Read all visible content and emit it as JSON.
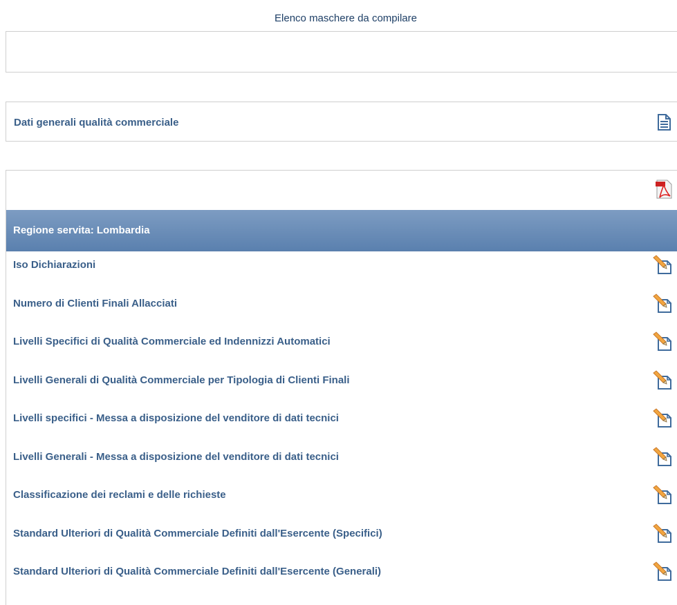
{
  "header": {
    "title": "Elenco maschere da compilare"
  },
  "general_section": {
    "label": "Dati generali qualità commerciale",
    "icon": "document-icon"
  },
  "list": {
    "pdf_icon": "pdf-icon",
    "region_header": "Regione servita: Lombardia",
    "items": [
      {
        "label": "Iso Dichiarazioni",
        "icon": "edit-icon"
      },
      {
        "label": "Numero di Clienti Finali Allacciati",
        "icon": "edit-icon"
      },
      {
        "label": "Livelli Specifici di Qualità Commerciale ed Indennizzi Automatici",
        "icon": "edit-icon"
      },
      {
        "label": "Livelli Generali di Qualità Commerciale per Tipologia di Clienti Finali",
        "icon": "edit-icon"
      },
      {
        "label": "Livelli specifici - Messa a disposizione del venditore di dati tecnici",
        "icon": "edit-icon"
      },
      {
        "label": "Livelli Generali - Messa a disposizione del venditore di dati tecnici",
        "icon": "edit-icon"
      },
      {
        "label": "Classificazione dei reclami e delle richieste",
        "icon": "edit-icon"
      },
      {
        "label": "Standard Ulteriori di Qualità Commerciale Definiti dall'Esercente (Specifici)",
        "icon": "edit-icon"
      },
      {
        "label": "Standard Ulteriori di Qualità Commerciale Definiti dall'Esercente (Generali)",
        "icon": "edit-icon"
      }
    ]
  },
  "colors": {
    "accent": "#5a80ae",
    "text": "#3a5f89",
    "border": "#cfcfcf"
  }
}
